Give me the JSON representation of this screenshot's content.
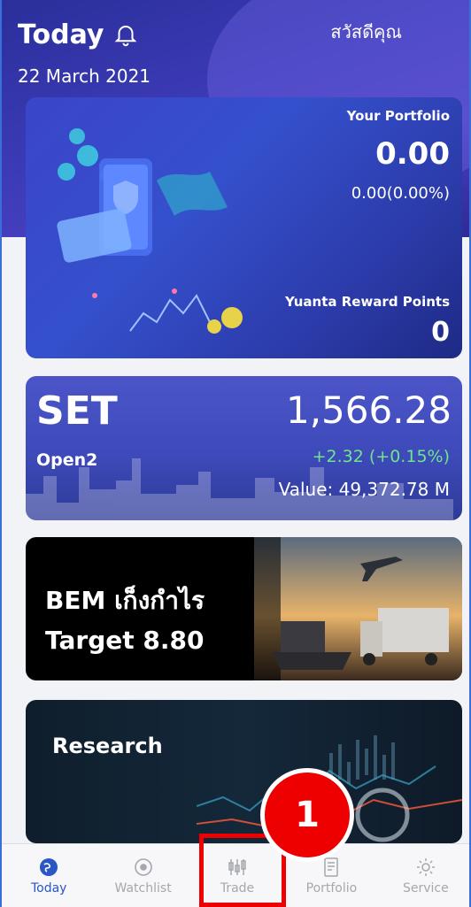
{
  "header": {
    "title": "Today",
    "greeting": "สวัสดีคุณ",
    "date": "22 March 2021"
  },
  "portfolio": {
    "label": "Your Portfolio",
    "value": "0.00",
    "change": "0.00(0.00%)",
    "reward_label": "Yuanta Reward Points",
    "reward_value": "0"
  },
  "market": {
    "name": "SET",
    "index": "1,566.28",
    "status": "Open2",
    "change": "+2.32 (+0.15%)",
    "value": "Value: 49,372.78 M",
    "change_color": "#6ee58a"
  },
  "news": {
    "line1": "BEM เก็งกำไร",
    "line2": "Target 8.80"
  },
  "research": {
    "title": "Research"
  },
  "tabs": [
    {
      "label": "Today",
      "icon": "globe-icon"
    },
    {
      "label": "Watchlist",
      "icon": "eye-icon"
    },
    {
      "label": "Trade",
      "icon": "trade-icon"
    },
    {
      "label": "Portfolio",
      "icon": "portfolio-icon"
    },
    {
      "label": "Service",
      "icon": "gear-icon"
    }
  ],
  "annotation": {
    "step": "1"
  },
  "colors": {
    "accent": "#2a56c6",
    "highlight": "#ee0000"
  }
}
